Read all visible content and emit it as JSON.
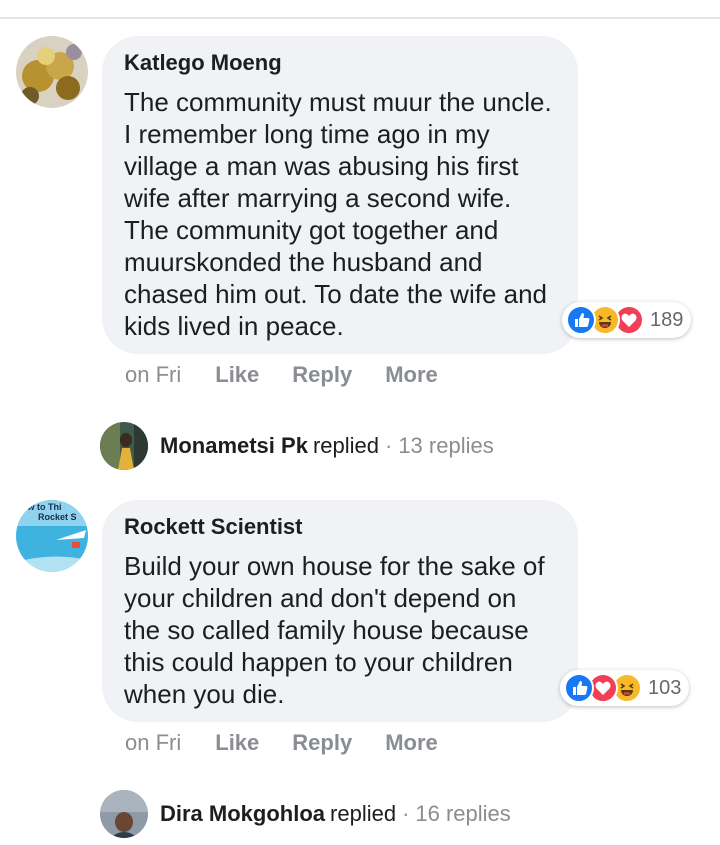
{
  "comments": [
    {
      "author": "Katlego Moeng",
      "text": "The community must muur the uncle. I remember long time ago in my village a man was abusing his first wife after marrying a second wife. The community got together and muurskonded the husband and chased him out. To date the wife and kids lived in peace.",
      "reactions": [
        "like",
        "haha",
        "love"
      ],
      "reaction_count": "189",
      "time": "on Fri",
      "actions": [
        "Like",
        "Reply",
        "More"
      ],
      "reply_summary": {
        "name": "Monametsi Pk",
        "verb": "replied",
        "dot": "·",
        "count": "13 replies"
      }
    },
    {
      "author": "Rockett Scientist",
      "avatar_text": "ow to Thi Rocket S",
      "text": "Build your own house for the sake of your children and don't depend on the so called family house because this could happen to your children when you die.",
      "reactions": [
        "like",
        "love",
        "haha"
      ],
      "reaction_count": "103",
      "time": "on Fri",
      "actions": [
        "Like",
        "Reply",
        "More"
      ],
      "reply_summary": {
        "name": "Dira Mokgohloa",
        "verb": "replied",
        "dot": "·",
        "count": "16 replies"
      }
    }
  ],
  "colors": {
    "bubble": "#f0f2f5",
    "like": "#1877f2",
    "love": "#f33e58",
    "haha": "#f7b928",
    "meta_text": "#8a8d91"
  }
}
